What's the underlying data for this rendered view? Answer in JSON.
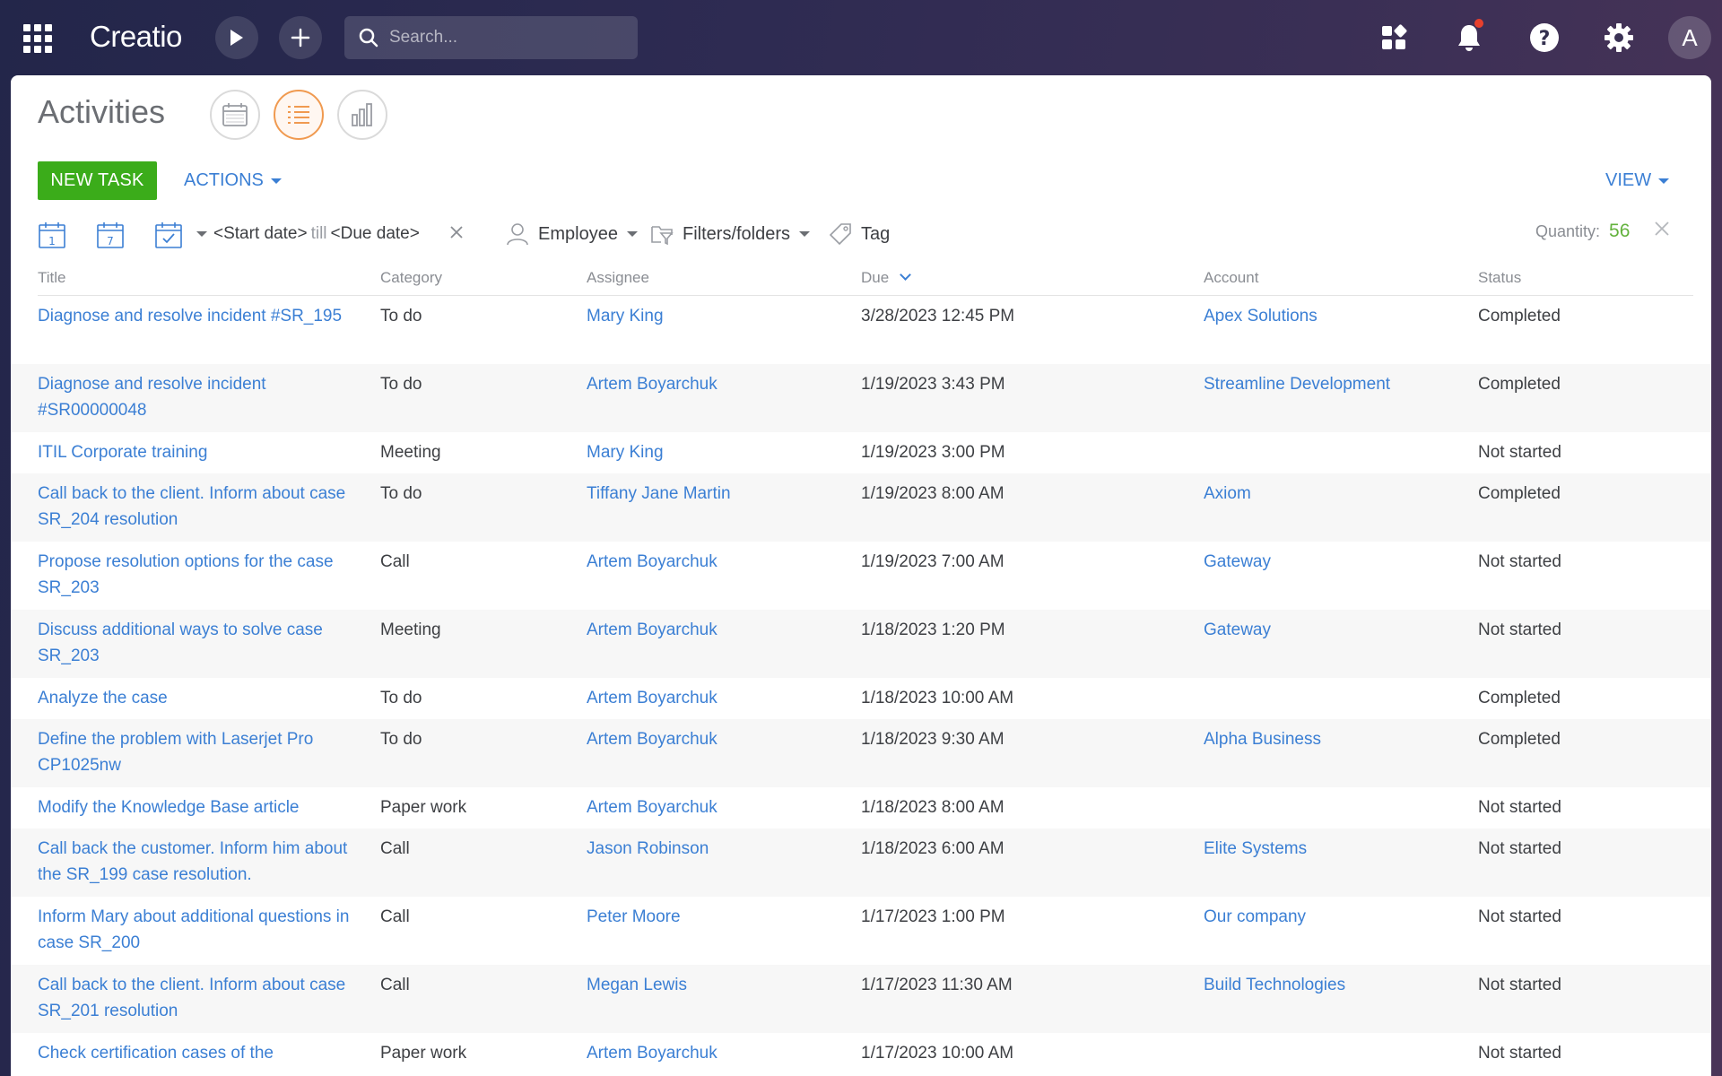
{
  "topbar": {
    "logo": "Creatio",
    "search_placeholder": "Search...",
    "avatar_letter": "A"
  },
  "page": {
    "title": "Activities",
    "new_task_label": "NEW TASK",
    "actions_label": "ACTIONS",
    "view_label": "VIEW"
  },
  "filters": {
    "start_date": "<Start date>",
    "till": "till",
    "due_date": "<Due date>",
    "employee": "Employee",
    "filters_folders": "Filters/folders",
    "tag": "Tag",
    "quantity_label": "Quantity:",
    "quantity_value": "56",
    "day_icon_number": "1",
    "week_icon_number": "7"
  },
  "columns": {
    "title": "Title",
    "category": "Category",
    "assignee": "Assignee",
    "due": "Due",
    "account": "Account",
    "status": "Status"
  },
  "rows": [
    {
      "title": "Diagnose and resolve incident #SR_195",
      "category": "To do",
      "assignee": "Mary King",
      "due": "3/28/2023 12:45 PM",
      "account": "Apex Solutions",
      "status": "Completed"
    },
    {
      "title": "Diagnose and resolve incident #SR00000048",
      "category": "To do",
      "assignee": "Artem Boyarchuk",
      "due": "1/19/2023 3:43 PM",
      "account": "Streamline Development",
      "status": "Completed"
    },
    {
      "title": "ITIL Corporate training",
      "category": "Meeting",
      "assignee": "Mary King",
      "due": "1/19/2023 3:00 PM",
      "account": "",
      "status": "Not started"
    },
    {
      "title": "Call back to the client. Inform about case SR_204 resolution",
      "category": "To do",
      "assignee": "Tiffany Jane Martin",
      "due": "1/19/2023 8:00 AM",
      "account": "Axiom",
      "status": "Completed"
    },
    {
      "title": "Propose resolution options for the case SR_203",
      "category": "Call",
      "assignee": "Artem Boyarchuk",
      "due": "1/19/2023 7:00 AM",
      "account": "Gateway",
      "status": "Not started"
    },
    {
      "title": "Discuss additional ways to solve case SR_203",
      "category": "Meeting",
      "assignee": "Artem Boyarchuk",
      "due": "1/18/2023 1:20 PM",
      "account": "Gateway",
      "status": "Not started"
    },
    {
      "title": "Analyze the case",
      "category": "To do",
      "assignee": "Artem Boyarchuk",
      "due": "1/18/2023 10:00 AM",
      "account": "",
      "status": "Completed"
    },
    {
      "title": "Define the problem with Laserjet Pro CP1025nw",
      "category": "To do",
      "assignee": "Artem Boyarchuk",
      "due": "1/18/2023 9:30 AM",
      "account": "Alpha Business",
      "status": "Completed"
    },
    {
      "title": "Modify the Knowledge Base article",
      "category": "Paper work",
      "assignee": "Artem Boyarchuk",
      "due": "1/18/2023 8:00 AM",
      "account": "",
      "status": "Not started"
    },
    {
      "title": "Call back the customer. Inform him about the SR_199 case resolution.",
      "category": "Call",
      "assignee": "Jason Robinson",
      "due": "1/18/2023 6:00 AM",
      "account": "Elite Systems",
      "status": "Not started"
    },
    {
      "title": "Inform Mary about additional questions in case SR_200",
      "category": "Call",
      "assignee": "Peter Moore",
      "due": "1/17/2023 1:00 PM",
      "account": "Our company",
      "status": "Not started"
    },
    {
      "title": "Call back to the client. Inform about case SR_201 resolution",
      "category": "Call",
      "assignee": "Megan Lewis",
      "due": "1/17/2023 11:30 AM",
      "account": "Build Technologies",
      "status": "Not started"
    },
    {
      "title": "Check certification cases of the",
      "category": "Paper work",
      "assignee": "Artem Boyarchuk",
      "due": "1/17/2023 10:00 AM",
      "account": "",
      "status": "Not started"
    }
  ],
  "colors": {
    "accent_link": "#3b7fd4",
    "new_task_green": "#3bac1a",
    "quantity_green": "#63b23d",
    "active_view_orange": "#f09a50"
  }
}
